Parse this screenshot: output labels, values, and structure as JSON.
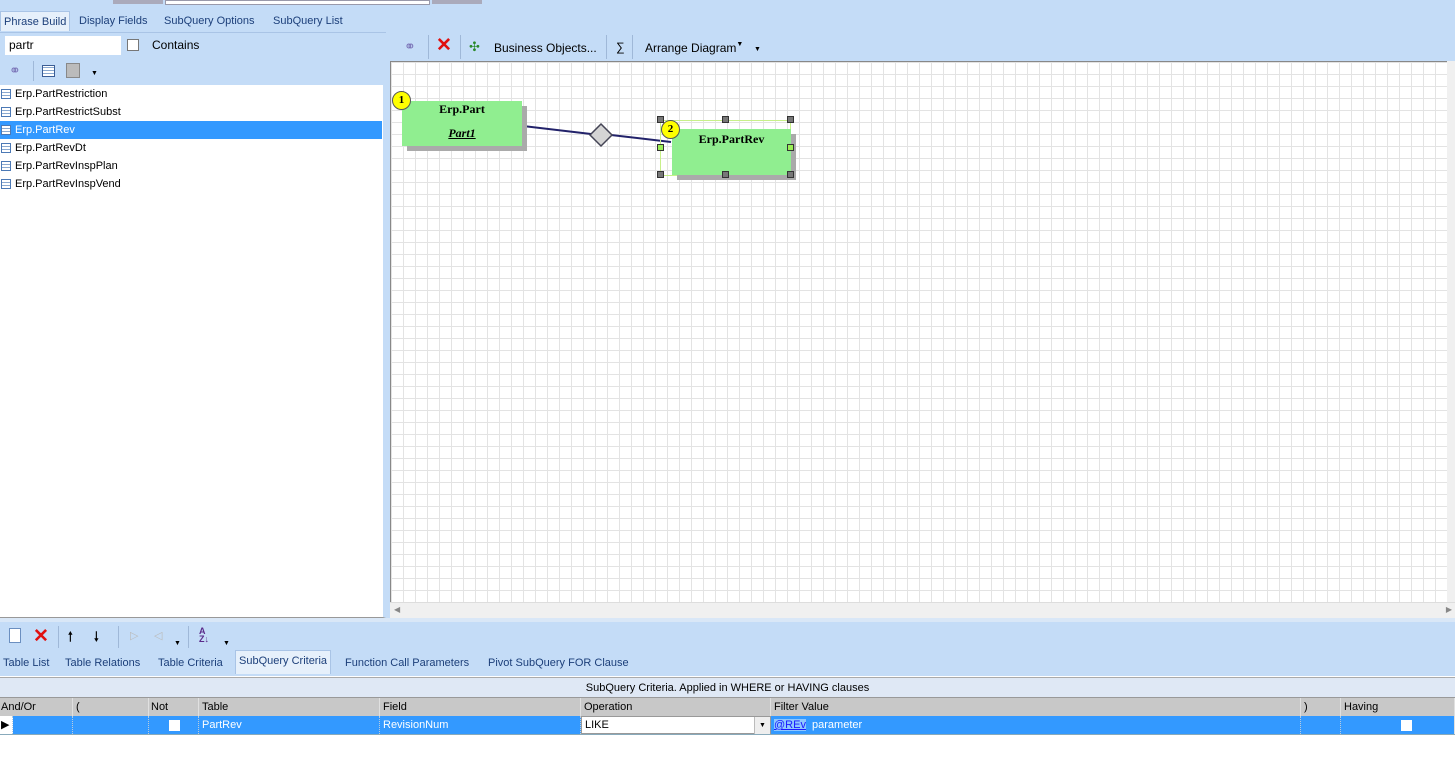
{
  "top_tabs": [
    "Phrase Build",
    "Display Fields",
    "SubQuery Options",
    "SubQuery List"
  ],
  "search": {
    "value": "partr",
    "contains_label": "Contains"
  },
  "table_list": [
    "Erp.PartRestriction",
    "Erp.PartRestrictSubst",
    "Erp.PartRev",
    "Erp.PartRevDt",
    "Erp.PartRevInspPlan",
    "Erp.PartRevInspVend"
  ],
  "selected_table": "Erp.PartRev",
  "diagram_toolbar": {
    "business_objects": "Business Objects...",
    "sum": "∑",
    "arrange": "Arrange Diagram"
  },
  "diagram": {
    "nodes": [
      {
        "num": "1",
        "title": "Erp.Part",
        "alias": "Part1"
      },
      {
        "num": "2",
        "title": "Erp.PartRev",
        "alias": ""
      }
    ]
  },
  "bottom_tabs": [
    "Table List",
    "Table Relations",
    "Table Criteria",
    "SubQuery Criteria",
    "Function Call Parameters",
    "Pivot SubQuery FOR Clause"
  ],
  "criteria": {
    "caption": "SubQuery Criteria. Applied in WHERE or HAVING clauses",
    "columns": [
      "And/Or",
      "(",
      "Not",
      "Table",
      "Field",
      "Operation",
      "Filter Value",
      ")",
      "Having"
    ],
    "row": {
      "andor": "",
      "open": "",
      "not": false,
      "table": "PartRev",
      "field": "RevisionNum",
      "operation": "LIKE",
      "filter_link": "@REv",
      "filter_text": "parameter",
      "close": "",
      "having": false
    }
  },
  "colors": {
    "panel": "#c4dcf7",
    "selection": "#3399ff",
    "node": "#90ee90"
  }
}
